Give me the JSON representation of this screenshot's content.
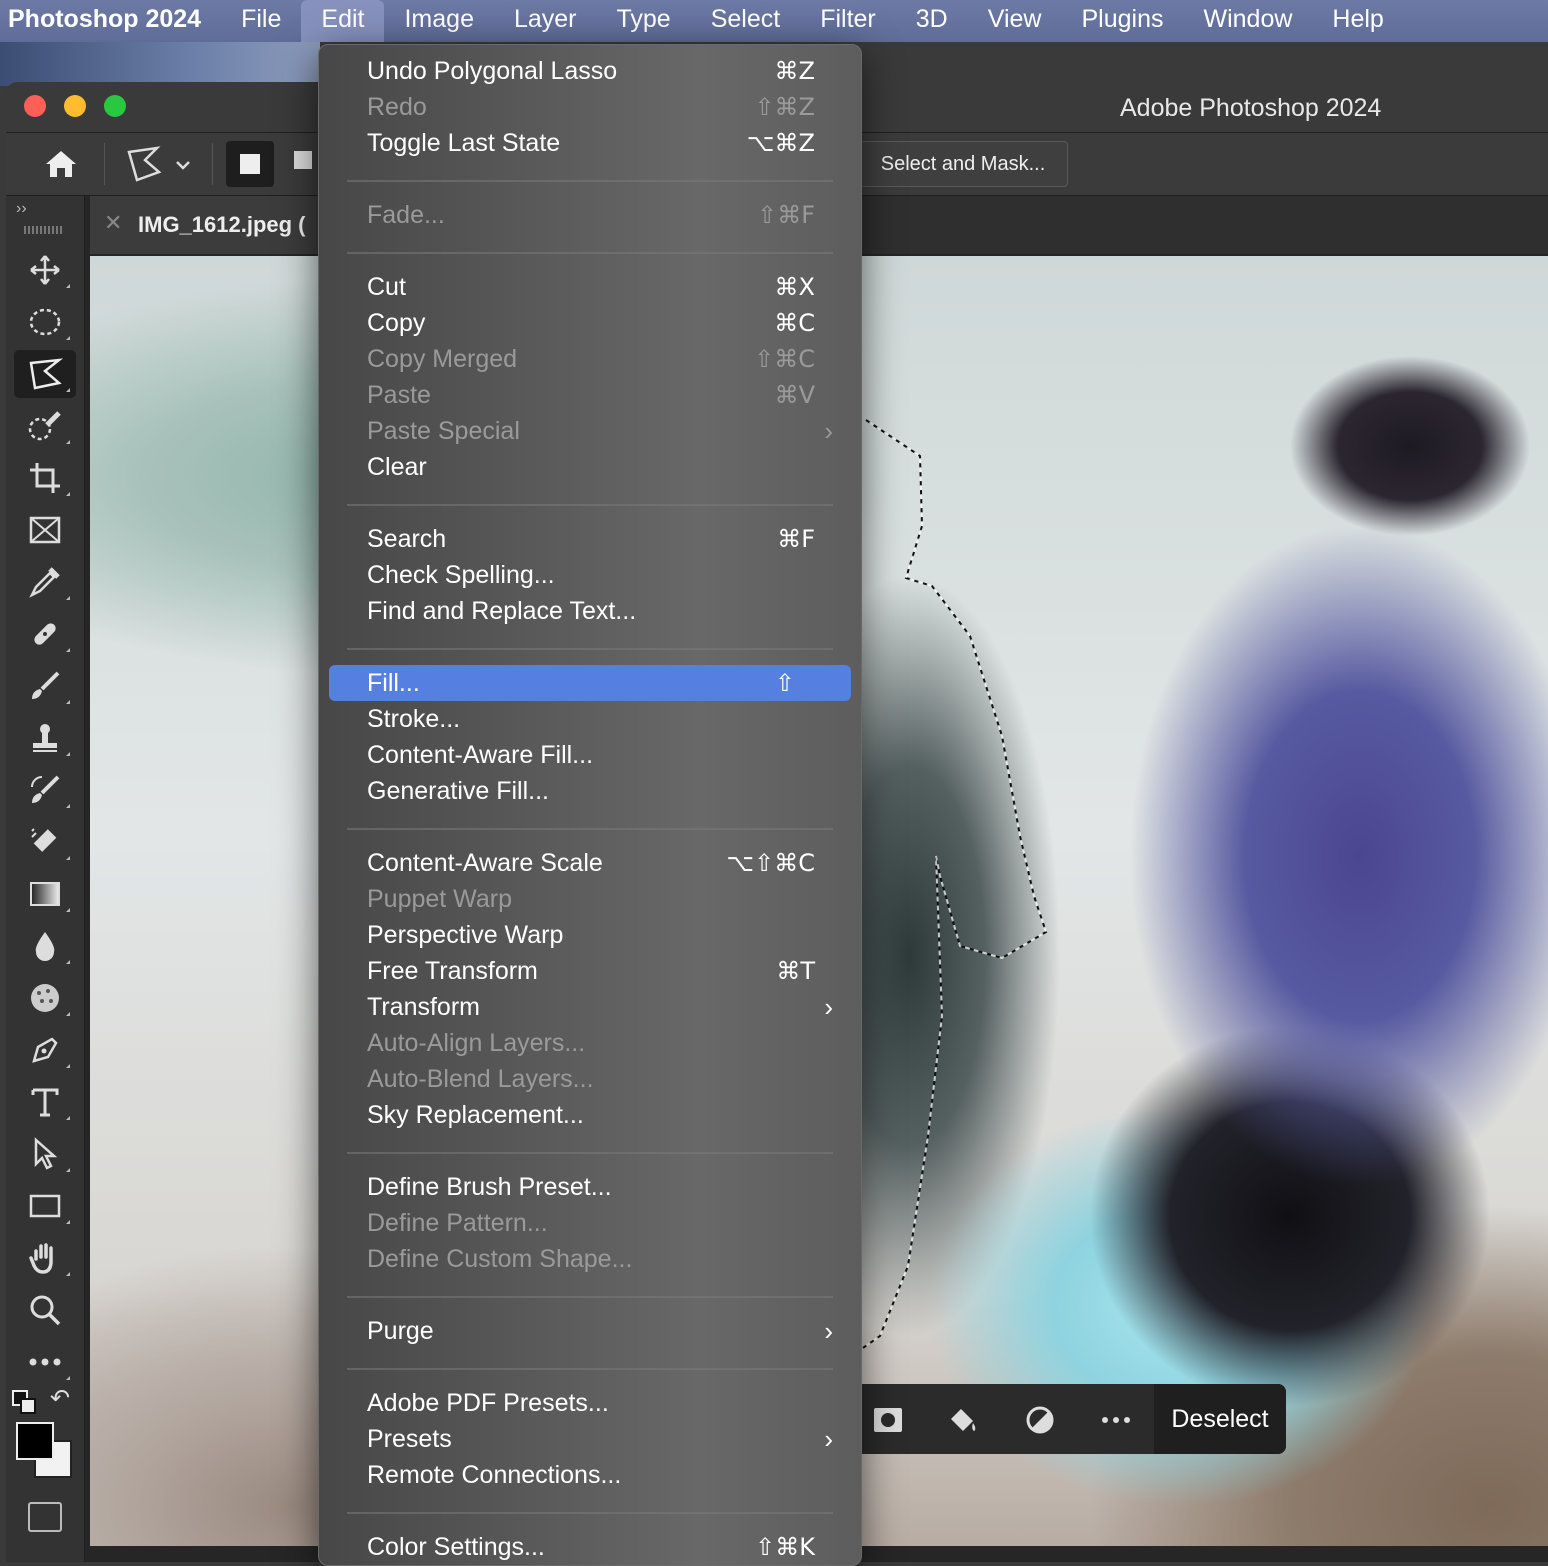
{
  "menubar": {
    "app": "Photoshop 2024",
    "items": [
      "File",
      "Edit",
      "Image",
      "Layer",
      "Type",
      "Select",
      "Filter",
      "3D",
      "View",
      "Plugins",
      "Window",
      "Help"
    ],
    "active": "Edit"
  },
  "window": {
    "title": "Adobe Photoshop 2024",
    "options": {
      "select_mask": "Select and Mask..."
    },
    "tab": {
      "name": "IMG_1612.jpeg (",
      "close": "✕"
    }
  },
  "context_bar": {
    "deselect": "Deselect"
  },
  "edit_menu": {
    "items": [
      {
        "label": "Undo Polygonal Lasso",
        "shortcut": "⌘Z",
        "enabled": true
      },
      {
        "label": "Redo",
        "shortcut": "⇧⌘Z",
        "enabled": false
      },
      {
        "label": "Toggle Last State",
        "shortcut": "⌥⌘Z",
        "enabled": true
      },
      {
        "label": "Fade...",
        "shortcut": "⇧⌘F",
        "enabled": false
      },
      {
        "label": "Cut",
        "shortcut": "⌘X",
        "enabled": true
      },
      {
        "label": "Copy",
        "shortcut": "⌘C",
        "enabled": true
      },
      {
        "label": "Copy Merged",
        "shortcut": "⇧⌘C",
        "enabled": false
      },
      {
        "label": "Paste",
        "shortcut": "⌘V",
        "enabled": false
      },
      {
        "label": "Paste Special",
        "shortcut": "",
        "enabled": false,
        "submenu": true
      },
      {
        "label": "Clear",
        "shortcut": "",
        "enabled": true
      },
      {
        "label": "Search",
        "shortcut": "⌘F",
        "enabled": true
      },
      {
        "label": "Check Spelling...",
        "shortcut": "",
        "enabled": true
      },
      {
        "label": "Find and Replace Text...",
        "shortcut": "",
        "enabled": true
      },
      {
        "label": "Fill...",
        "shortcut": "⇧",
        "enabled": true,
        "highlighted": true
      },
      {
        "label": "Stroke...",
        "shortcut": "",
        "enabled": true
      },
      {
        "label": "Content-Aware Fill...",
        "shortcut": "",
        "enabled": true
      },
      {
        "label": "Generative Fill...",
        "shortcut": "",
        "enabled": true
      },
      {
        "label": "Content-Aware Scale",
        "shortcut": "⌥⇧⌘C",
        "enabled": true
      },
      {
        "label": "Puppet Warp",
        "shortcut": "",
        "enabled": false
      },
      {
        "label": "Perspective Warp",
        "shortcut": "",
        "enabled": true
      },
      {
        "label": "Free Transform",
        "shortcut": "⌘T",
        "enabled": true
      },
      {
        "label": "Transform",
        "shortcut": "",
        "enabled": true,
        "submenu": true
      },
      {
        "label": "Auto-Align Layers...",
        "shortcut": "",
        "enabled": false
      },
      {
        "label": "Auto-Blend Layers...",
        "shortcut": "",
        "enabled": false
      },
      {
        "label": "Sky Replacement...",
        "shortcut": "",
        "enabled": true
      },
      {
        "label": "Define Brush Preset...",
        "shortcut": "",
        "enabled": true
      },
      {
        "label": "Define Pattern...",
        "shortcut": "",
        "enabled": false
      },
      {
        "label": "Define Custom Shape...",
        "shortcut": "",
        "enabled": false
      },
      {
        "label": "Purge",
        "shortcut": "",
        "enabled": true,
        "submenu": true
      },
      {
        "label": "Adobe PDF Presets...",
        "shortcut": "",
        "enabled": true
      },
      {
        "label": "Presets",
        "shortcut": "",
        "enabled": true,
        "submenu": true
      },
      {
        "label": "Remote Connections...",
        "shortcut": "",
        "enabled": true
      },
      {
        "label": "Color Settings...",
        "shortcut": "⇧⌘K",
        "enabled": true
      }
    ]
  },
  "icons": {
    "tools": [
      "move-icon",
      "ellipse-marquee-icon",
      "polygonal-lasso-icon",
      "quick-selection-icon",
      "crop-icon",
      "frame-icon",
      "eyedropper-icon",
      "healing-brush-icon",
      "brush-icon",
      "clone-stamp-icon",
      "history-brush-icon",
      "eraser-icon",
      "gradient-icon",
      "blur-icon",
      "sponge-icon",
      "pen-icon",
      "type-icon",
      "path-selection-icon",
      "rectangle-icon",
      "hand-icon",
      "zoom-icon",
      "more-tools-icon"
    ]
  },
  "colors": {
    "highlight": "#5580e0",
    "close": "#fe5f57",
    "minimize": "#febc2e",
    "zoom": "#28c840"
  }
}
